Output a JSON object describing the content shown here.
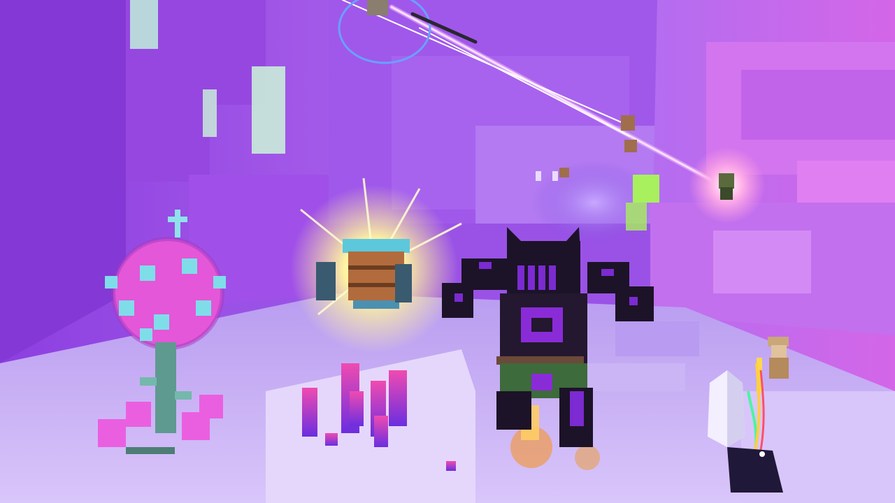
{
  "scene": {
    "title": "",
    "description_hidden": true,
    "palette": {
      "sky_wall": "#8f4fe0",
      "wall_light": "#b86af0",
      "wall_pink": "#d05be6",
      "floor": "#c8aef5",
      "floor_light": "#e2d2fb",
      "glow": "#fff6a8",
      "armor_dark": "#1c1328",
      "armor_accent": "#8a2bd8",
      "crystal_pink": "#e64ad8",
      "crystal_cyan": "#7fe6ef",
      "green_block": "#a4f05a"
    },
    "entities": [
      {
        "id": "player",
        "icon": "armored-knight-icon"
      },
      {
        "id": "crystal-tree",
        "icon": "crystal-tree-icon"
      },
      {
        "id": "barrel-enemy",
        "icon": "barrel-enemy-icon"
      },
      {
        "id": "grapple-beams",
        "icon": "grapple-beam-icon"
      },
      {
        "id": "ally-top-right",
        "icon": "ally-character-icon"
      },
      {
        "id": "ally-bottom-right",
        "icon": "ally-character-icon"
      },
      {
        "id": "crystal-spikes",
        "icon": "crystal-spike-icon"
      },
      {
        "id": "white-crystal",
        "icon": "white-crystal-icon"
      }
    ]
  }
}
